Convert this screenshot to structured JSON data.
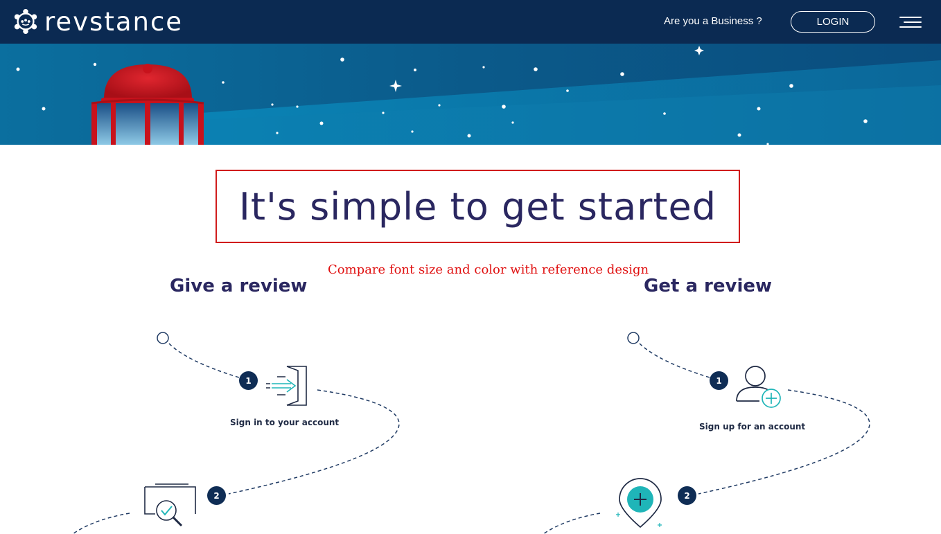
{
  "header": {
    "brand": "revstance",
    "business_link": "Are you a Business ?",
    "login_label": "LOGIN"
  },
  "main": {
    "headline": "It's simple to get started",
    "note": "Compare font size and color with reference design",
    "give": {
      "title": "Give a review",
      "steps": [
        {
          "number": "1",
          "caption": "Sign in to your account"
        },
        {
          "number": "2",
          "caption": ""
        }
      ]
    },
    "get": {
      "title": "Get a review",
      "steps": [
        {
          "number": "1",
          "caption": "Sign up for an account"
        },
        {
          "number": "2",
          "caption": ""
        }
      ]
    }
  },
  "colors": {
    "header_bg": "#0b2a52",
    "headline": "#2a2760",
    "accent_teal": "#1fb5b8",
    "badge": "#0f2d55",
    "note_red": "#e01010",
    "lighthouse_red": "#c8121c"
  }
}
